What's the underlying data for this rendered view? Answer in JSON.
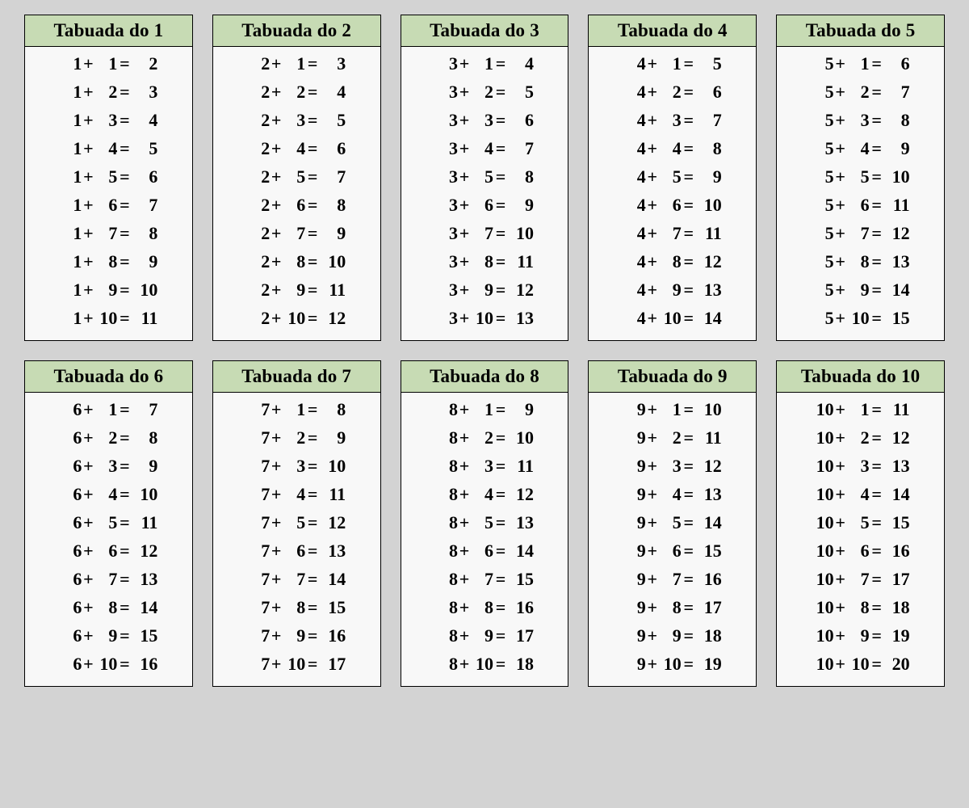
{
  "title_prefix": "Tabuada do",
  "operator": "+",
  "equals": "=",
  "tables": [
    {
      "n": 1,
      "rows": [
        {
          "a": 1,
          "b": 1,
          "r": 2
        },
        {
          "a": 1,
          "b": 2,
          "r": 3
        },
        {
          "a": 1,
          "b": 3,
          "r": 4
        },
        {
          "a": 1,
          "b": 4,
          "r": 5
        },
        {
          "a": 1,
          "b": 5,
          "r": 6
        },
        {
          "a": 1,
          "b": 6,
          "r": 7
        },
        {
          "a": 1,
          "b": 7,
          "r": 8
        },
        {
          "a": 1,
          "b": 8,
          "r": 9
        },
        {
          "a": 1,
          "b": 9,
          "r": 10
        },
        {
          "a": 1,
          "b": 10,
          "r": 11
        }
      ]
    },
    {
      "n": 2,
      "rows": [
        {
          "a": 2,
          "b": 1,
          "r": 3
        },
        {
          "a": 2,
          "b": 2,
          "r": 4
        },
        {
          "a": 2,
          "b": 3,
          "r": 5
        },
        {
          "a": 2,
          "b": 4,
          "r": 6
        },
        {
          "a": 2,
          "b": 5,
          "r": 7
        },
        {
          "a": 2,
          "b": 6,
          "r": 8
        },
        {
          "a": 2,
          "b": 7,
          "r": 9
        },
        {
          "a": 2,
          "b": 8,
          "r": 10
        },
        {
          "a": 2,
          "b": 9,
          "r": 11
        },
        {
          "a": 2,
          "b": 10,
          "r": 12
        }
      ]
    },
    {
      "n": 3,
      "rows": [
        {
          "a": 3,
          "b": 1,
          "r": 4
        },
        {
          "a": 3,
          "b": 2,
          "r": 5
        },
        {
          "a": 3,
          "b": 3,
          "r": 6
        },
        {
          "a": 3,
          "b": 4,
          "r": 7
        },
        {
          "a": 3,
          "b": 5,
          "r": 8
        },
        {
          "a": 3,
          "b": 6,
          "r": 9
        },
        {
          "a": 3,
          "b": 7,
          "r": 10
        },
        {
          "a": 3,
          "b": 8,
          "r": 11
        },
        {
          "a": 3,
          "b": 9,
          "r": 12
        },
        {
          "a": 3,
          "b": 10,
          "r": 13
        }
      ]
    },
    {
      "n": 4,
      "rows": [
        {
          "a": 4,
          "b": 1,
          "r": 5
        },
        {
          "a": 4,
          "b": 2,
          "r": 6
        },
        {
          "a": 4,
          "b": 3,
          "r": 7
        },
        {
          "a": 4,
          "b": 4,
          "r": 8
        },
        {
          "a": 4,
          "b": 5,
          "r": 9
        },
        {
          "a": 4,
          "b": 6,
          "r": 10
        },
        {
          "a": 4,
          "b": 7,
          "r": 11
        },
        {
          "a": 4,
          "b": 8,
          "r": 12
        },
        {
          "a": 4,
          "b": 9,
          "r": 13
        },
        {
          "a": 4,
          "b": 10,
          "r": 14
        }
      ]
    },
    {
      "n": 5,
      "rows": [
        {
          "a": 5,
          "b": 1,
          "r": 6
        },
        {
          "a": 5,
          "b": 2,
          "r": 7
        },
        {
          "a": 5,
          "b": 3,
          "r": 8
        },
        {
          "a": 5,
          "b": 4,
          "r": 9
        },
        {
          "a": 5,
          "b": 5,
          "r": 10
        },
        {
          "a": 5,
          "b": 6,
          "r": 11
        },
        {
          "a": 5,
          "b": 7,
          "r": 12
        },
        {
          "a": 5,
          "b": 8,
          "r": 13
        },
        {
          "a": 5,
          "b": 9,
          "r": 14
        },
        {
          "a": 5,
          "b": 10,
          "r": 15
        }
      ]
    },
    {
      "n": 6,
      "rows": [
        {
          "a": 6,
          "b": 1,
          "r": 7
        },
        {
          "a": 6,
          "b": 2,
          "r": 8
        },
        {
          "a": 6,
          "b": 3,
          "r": 9
        },
        {
          "a": 6,
          "b": 4,
          "r": 10
        },
        {
          "a": 6,
          "b": 5,
          "r": 11
        },
        {
          "a": 6,
          "b": 6,
          "r": 12
        },
        {
          "a": 6,
          "b": 7,
          "r": 13
        },
        {
          "a": 6,
          "b": 8,
          "r": 14
        },
        {
          "a": 6,
          "b": 9,
          "r": 15
        },
        {
          "a": 6,
          "b": 10,
          "r": 16
        }
      ]
    },
    {
      "n": 7,
      "rows": [
        {
          "a": 7,
          "b": 1,
          "r": 8
        },
        {
          "a": 7,
          "b": 2,
          "r": 9
        },
        {
          "a": 7,
          "b": 3,
          "r": 10
        },
        {
          "a": 7,
          "b": 4,
          "r": 11
        },
        {
          "a": 7,
          "b": 5,
          "r": 12
        },
        {
          "a": 7,
          "b": 6,
          "r": 13
        },
        {
          "a": 7,
          "b": 7,
          "r": 14
        },
        {
          "a": 7,
          "b": 8,
          "r": 15
        },
        {
          "a": 7,
          "b": 9,
          "r": 16
        },
        {
          "a": 7,
          "b": 10,
          "r": 17
        }
      ]
    },
    {
      "n": 8,
      "rows": [
        {
          "a": 8,
          "b": 1,
          "r": 9
        },
        {
          "a": 8,
          "b": 2,
          "r": 10
        },
        {
          "a": 8,
          "b": 3,
          "r": 11
        },
        {
          "a": 8,
          "b": 4,
          "r": 12
        },
        {
          "a": 8,
          "b": 5,
          "r": 13
        },
        {
          "a": 8,
          "b": 6,
          "r": 14
        },
        {
          "a": 8,
          "b": 7,
          "r": 15
        },
        {
          "a": 8,
          "b": 8,
          "r": 16
        },
        {
          "a": 8,
          "b": 9,
          "r": 17
        },
        {
          "a": 8,
          "b": 10,
          "r": 18
        }
      ]
    },
    {
      "n": 9,
      "rows": [
        {
          "a": 9,
          "b": 1,
          "r": 10
        },
        {
          "a": 9,
          "b": 2,
          "r": 11
        },
        {
          "a": 9,
          "b": 3,
          "r": 12
        },
        {
          "a": 9,
          "b": 4,
          "r": 13
        },
        {
          "a": 9,
          "b": 5,
          "r": 14
        },
        {
          "a": 9,
          "b": 6,
          "r": 15
        },
        {
          "a": 9,
          "b": 7,
          "r": 16
        },
        {
          "a": 9,
          "b": 8,
          "r": 17
        },
        {
          "a": 9,
          "b": 9,
          "r": 18
        },
        {
          "a": 9,
          "b": 10,
          "r": 19
        }
      ]
    },
    {
      "n": 10,
      "rows": [
        {
          "a": 10,
          "b": 1,
          "r": 11
        },
        {
          "a": 10,
          "b": 2,
          "r": 12
        },
        {
          "a": 10,
          "b": 3,
          "r": 13
        },
        {
          "a": 10,
          "b": 4,
          "r": 14
        },
        {
          "a": 10,
          "b": 5,
          "r": 15
        },
        {
          "a": 10,
          "b": 6,
          "r": 16
        },
        {
          "a": 10,
          "b": 7,
          "r": 17
        },
        {
          "a": 10,
          "b": 8,
          "r": 18
        },
        {
          "a": 10,
          "b": 9,
          "r": 19
        },
        {
          "a": 10,
          "b": 10,
          "r": 20
        }
      ]
    }
  ]
}
